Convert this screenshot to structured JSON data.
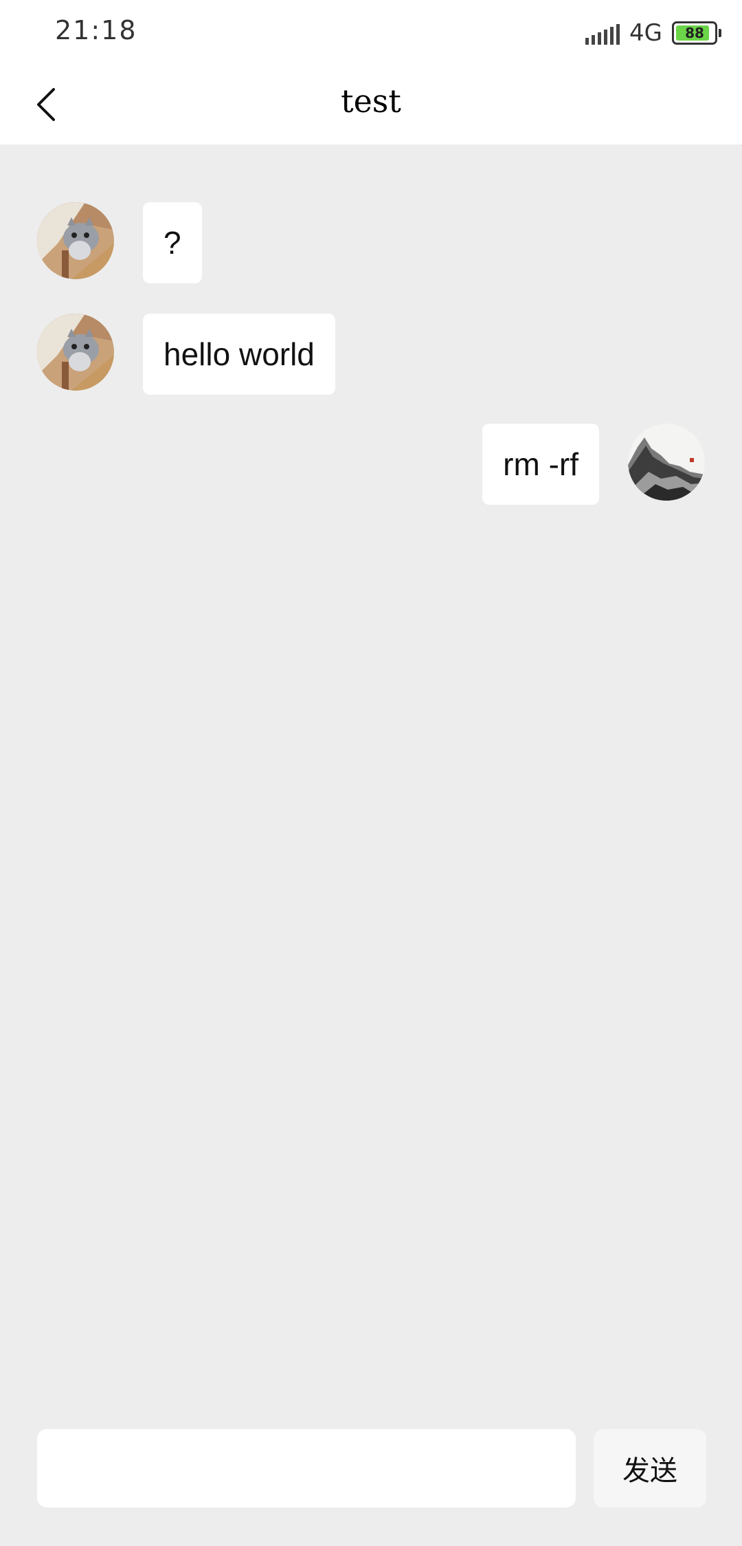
{
  "status_bar": {
    "time": "21:18",
    "network": "4G",
    "battery_level": "88",
    "battery_color": "#6bd448",
    "icons": [
      "signal-icon",
      "battery-icon"
    ]
  },
  "header": {
    "title": "test",
    "back_icon": "chevron-left-icon"
  },
  "messages": [
    {
      "side": "left",
      "avatar": "cat-photo-avatar",
      "text": "?"
    },
    {
      "side": "left",
      "avatar": "cat-photo-avatar",
      "text": "hello world"
    },
    {
      "side": "right",
      "avatar": "ink-mountain-avatar",
      "text": "rm -rf"
    }
  ],
  "composer": {
    "input_value": "",
    "placeholder": "",
    "send_label": "发送"
  },
  "colors": {
    "background": "#ededed",
    "bubble": "#ffffff",
    "bar": "#ffffff"
  }
}
